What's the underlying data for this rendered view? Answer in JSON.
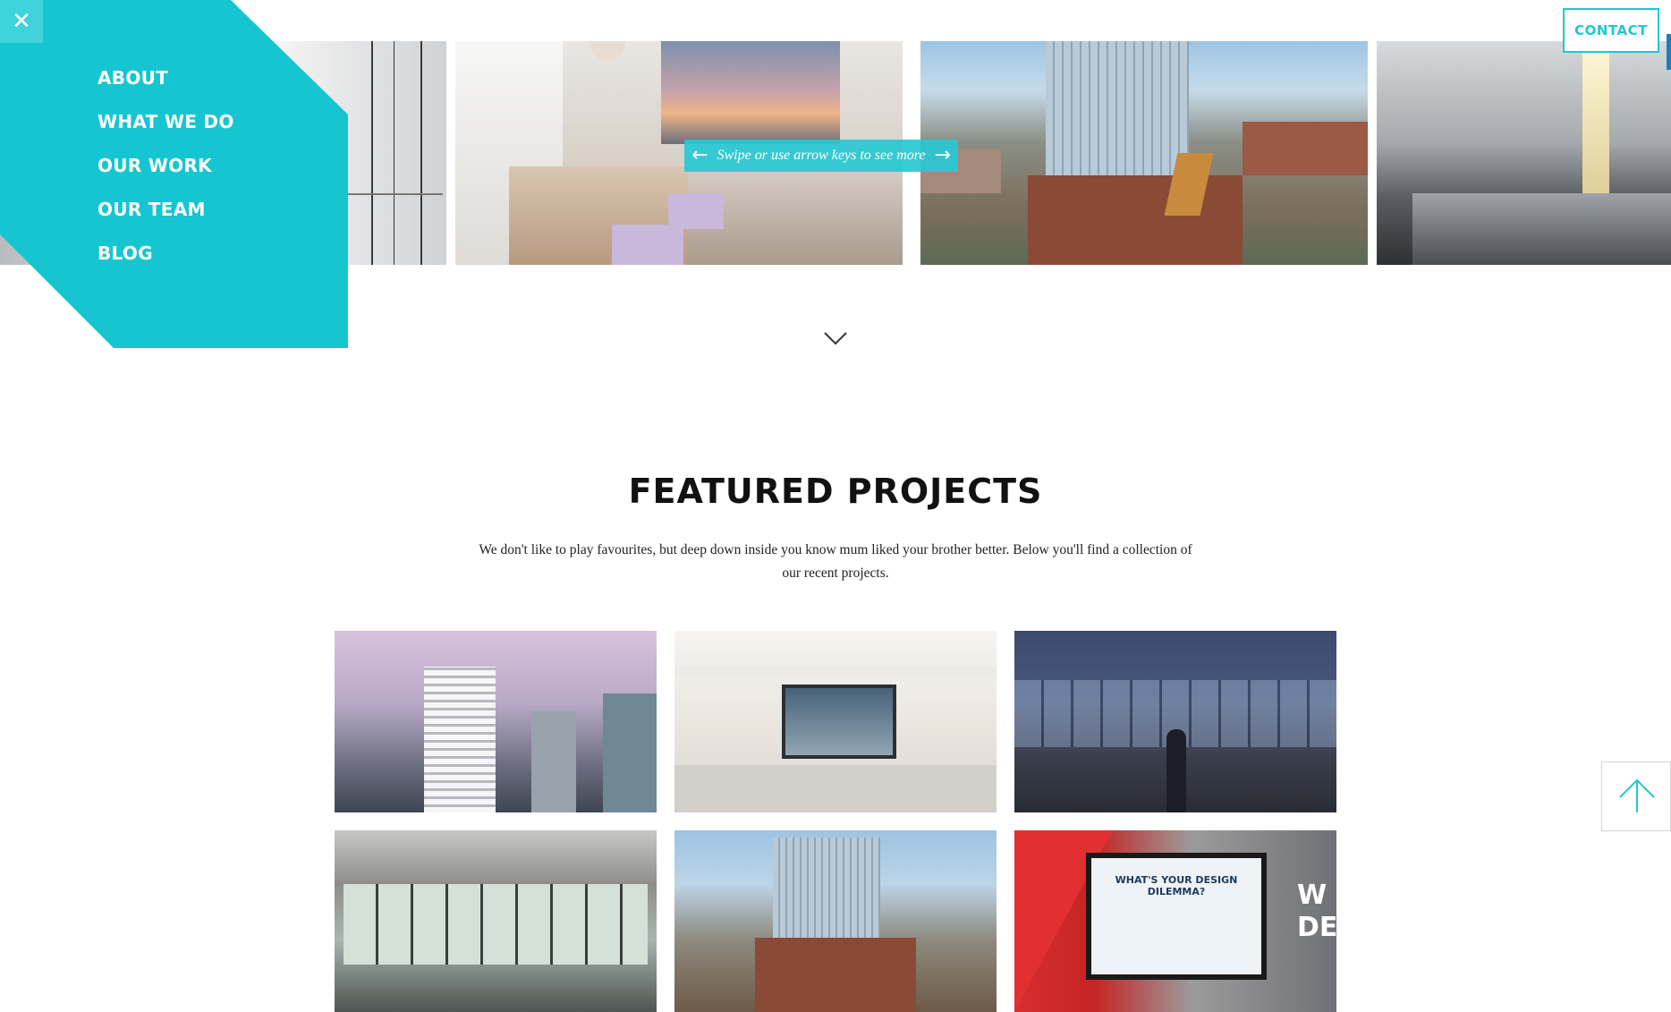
{
  "menu": {
    "close_symbol": "✕",
    "items": [
      {
        "label": "ABOUT"
      },
      {
        "label": "WHAT WE DO"
      },
      {
        "label": "OUR WORK"
      },
      {
        "label": "OUR TEAM"
      },
      {
        "label": "BLOG"
      }
    ],
    "color": "#15c6d0"
  },
  "header": {
    "contact_label": "CONTACT"
  },
  "carousel": {
    "hint": "Swipe or use arrow keys to see more",
    "prev_arrow": "←",
    "next_arrow": "→"
  },
  "featured": {
    "title": "FEATURED PROJECTS",
    "description": "We don't like to play favourites, but deep down inside you know mum liked your brother better. Below you'll find a collection of our recent projects.",
    "screen_text": "WHAT'S YOUR DESIGN DILEMMA?",
    "side_text": "W DES"
  },
  "icons": {
    "close": "close-icon",
    "scroll": "chevron-down-icon",
    "back_to_top": "arrow-up-icon"
  },
  "colors": {
    "accent": "#15c6d0",
    "contact_border": "#1ec8d2"
  }
}
